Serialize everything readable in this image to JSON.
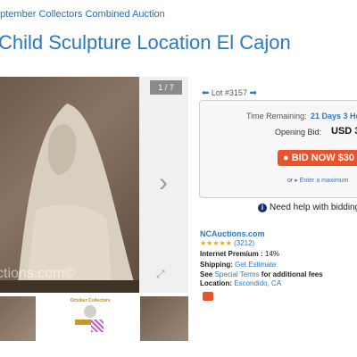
{
  "breadcrumb": "eptember Collectors Combined Auction",
  "title": "Child Sculpture Location El Cajon",
  "gallery": {
    "counter": "1 / 7",
    "watermark": "ctions.com©"
  },
  "lot": {
    "label": "Lot #3157"
  },
  "bid_box": {
    "time_label": "Time Remaining:",
    "time_value": "21 Days 3 Ho",
    "opening_label": "Opening Bid:",
    "opening_value": "USD 3",
    "bid_button": "BID NOW $30",
    "or_text": "or",
    "max_link": "Enter a maximum"
  },
  "help": {
    "text": "Need help with bidding?"
  },
  "seller": {
    "name": "NCAuctions.com",
    "stars": "★★★★★",
    "rating_count": "(3212)",
    "premium_label": "Internet Premium :",
    "premium_value": "14%",
    "shipping_label": "Shipping:",
    "shipping_value": "Get Estimate",
    "terms_prefix": "See",
    "terms_link": "Special Terms",
    "terms_suffix": "for additional fees",
    "location_label": "Location:",
    "location_value": "Escondido, CA"
  },
  "thumbs": {
    "t2_title": "October Collectors"
  },
  "colors": {
    "link": "#2b78c2",
    "bid_button": "#e8532b",
    "stars": "#f0a500"
  }
}
